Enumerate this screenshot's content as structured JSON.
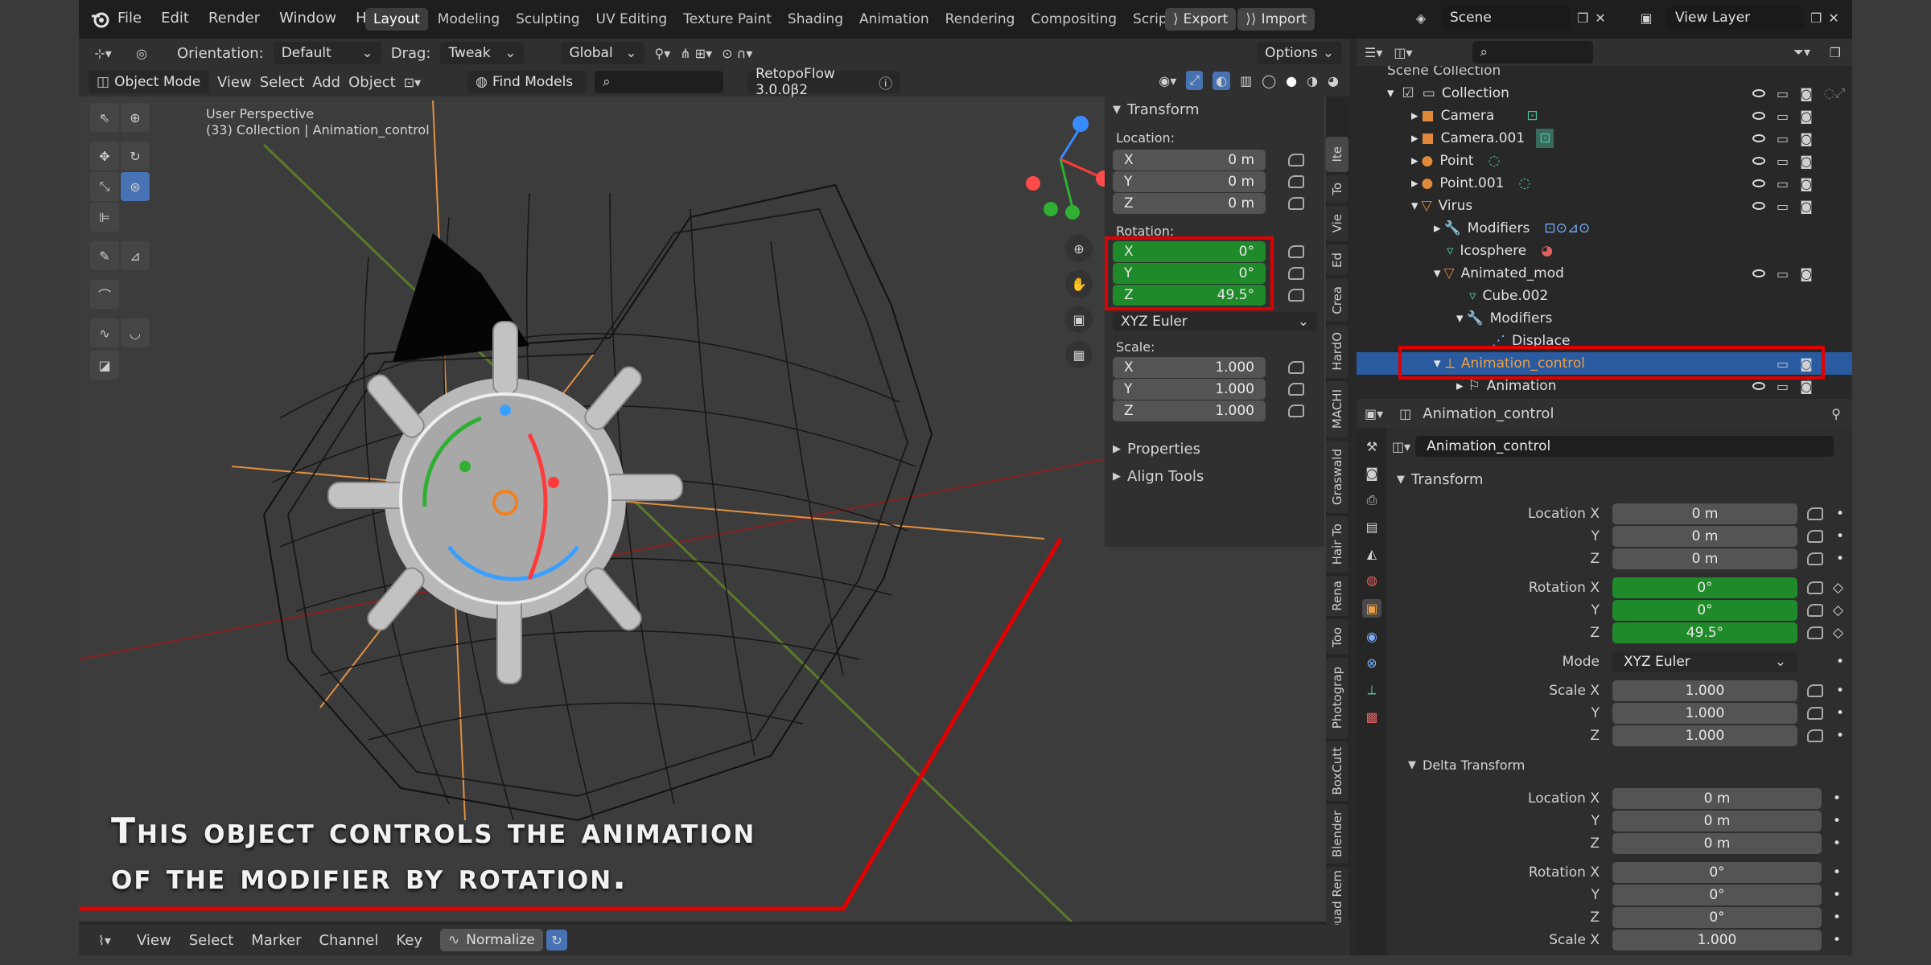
{
  "menu": {
    "items": [
      "File",
      "Edit",
      "Render",
      "Window",
      "Help"
    ]
  },
  "workspaces": [
    "Layout",
    "Modeling",
    "Sculpting",
    "UV Editing",
    "Texture Paint",
    "Shading",
    "Animation",
    "Rendering",
    "Compositing",
    "Scripting"
  ],
  "active_workspace": "Layout",
  "top_right": {
    "export": "Export",
    "import": "Import",
    "scene": "Scene",
    "view_layer": "View Layer"
  },
  "header2": {
    "orientation_label": "Orientation:",
    "orientation_value": "Default",
    "drag_label": "Drag:",
    "drag_value": "Tweak",
    "transform_value": "Global",
    "options": "Options"
  },
  "header3": {
    "mode": "Object Mode",
    "view": "View",
    "select": "Select",
    "add": "Add",
    "object": "Object",
    "find_models": "Find Models",
    "retopo": "RetopoFlow 3.0.0β2"
  },
  "viewport": {
    "title": "User Perspective",
    "subtitle": "(33) Collection | Animation_control"
  },
  "npanel": {
    "transform": "Transform",
    "location_label": "Location:",
    "location": [
      {
        "axis": "X",
        "value": "0 m"
      },
      {
        "axis": "Y",
        "value": "0 m"
      },
      {
        "axis": "Z",
        "value": "0 m"
      }
    ],
    "rotation_label": "Rotation:",
    "rotation": [
      {
        "axis": "X",
        "value": "0°"
      },
      {
        "axis": "Y",
        "value": "0°"
      },
      {
        "axis": "Z",
        "value": "49.5°"
      }
    ],
    "rotation_mode": "XYZ Euler",
    "scale_label": "Scale:",
    "scale": [
      {
        "axis": "X",
        "value": "1.000"
      },
      {
        "axis": "Y",
        "value": "1.000"
      },
      {
        "axis": "Z",
        "value": "1.000"
      }
    ],
    "properties": "Properties",
    "align_tools": "Align Tools"
  },
  "side_tabs": [
    "Ite",
    "To",
    "Vie",
    "Ed",
    "Crea",
    "HardO",
    "MACHI",
    "Graswald",
    "Hair To",
    "Rena",
    "Too",
    "Photograp",
    "BoxCutt",
    "Blender",
    "Quad Rem"
  ],
  "outliner": {
    "scene_collection": "Scene Collection",
    "rows": [
      "Collection",
      "Camera",
      "Camera.001",
      "Point",
      "Point.001",
      "Virus",
      "Modifiers",
      "Icosphere",
      "Animated_mod",
      "Cube.002",
      "Modifiers",
      "Displace",
      "Animation_control",
      "Animation"
    ]
  },
  "properties": {
    "object_name": "Animation_control",
    "name_field": "Animation_control",
    "transform": "Transform",
    "location": [
      {
        "label": "Location X",
        "value": "0 m"
      },
      {
        "label": "Y",
        "value": "0 m"
      },
      {
        "label": "Z",
        "value": "0 m"
      }
    ],
    "rotation": [
      {
        "label": "Rotation X",
        "value": "0°"
      },
      {
        "label": "Y",
        "value": "0°"
      },
      {
        "label": "Z",
        "value": "49.5°"
      }
    ],
    "mode_label": "Mode",
    "mode_value": "XYZ Euler",
    "scale": [
      {
        "label": "Scale X",
        "value": "1.000"
      },
      {
        "label": "Y",
        "value": "1.000"
      },
      {
        "label": "Z",
        "value": "1.000"
      }
    ],
    "delta": "Delta Transform",
    "delta_location": [
      {
        "label": "Location X",
        "value": "0 m"
      },
      {
        "label": "Y",
        "value": "0 m"
      },
      {
        "label": "Z",
        "value": "0 m"
      }
    ],
    "delta_rotation": [
      {
        "label": "Rotation X",
        "value": "0°"
      },
      {
        "label": "Y",
        "value": "0°"
      },
      {
        "label": "Z",
        "value": "0°"
      }
    ],
    "delta_scale": [
      {
        "label": "Scale X",
        "value": "1.000"
      }
    ]
  },
  "timeline": {
    "view": "View",
    "select": "Select",
    "marker": "Marker",
    "channel": "Channel",
    "key": "Key",
    "normalize": "Normalize"
  },
  "caption": {
    "line1": "This object controls the animation",
    "line2": "of the modifier by rotation."
  },
  "colors": {
    "accent_green": "#1f8a29",
    "highlight_red": "#e00000",
    "selected_blue": "#2a5aa0",
    "active_orange": "#f0a040"
  }
}
